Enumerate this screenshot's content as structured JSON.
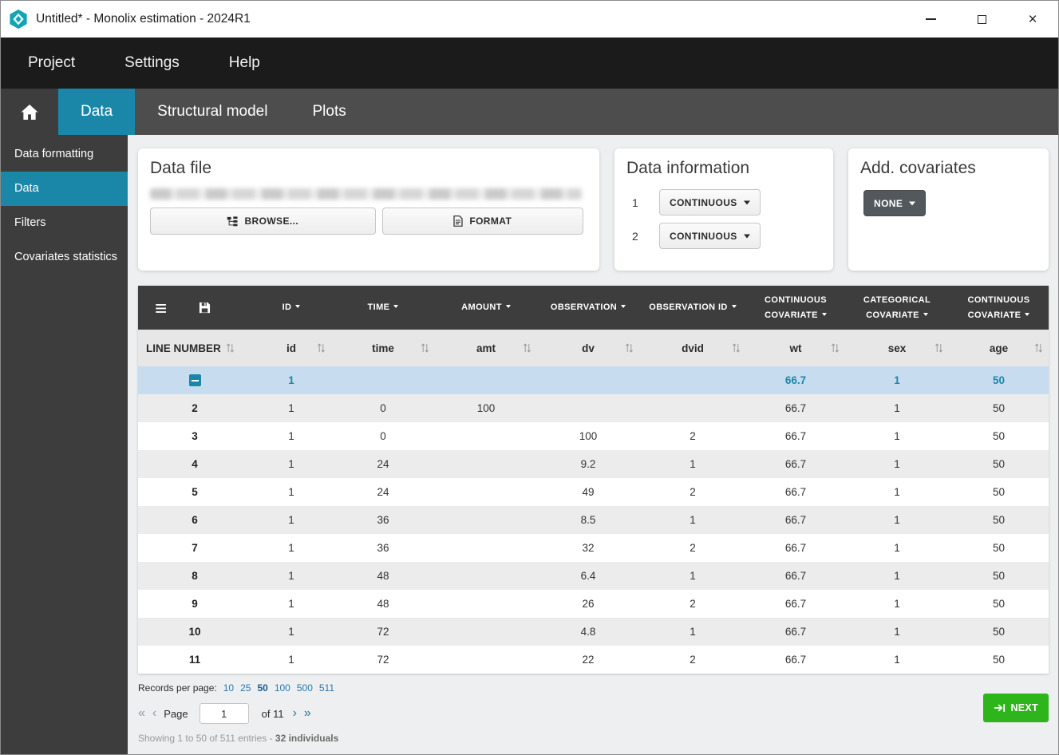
{
  "window": {
    "title": "Untitled* - Monolix estimation - 2024R1"
  },
  "icons": {
    "hamburger": "≡",
    "close": "×"
  },
  "menubar": {
    "items": [
      {
        "label": "Project"
      },
      {
        "label": "Settings"
      },
      {
        "label": "Help"
      }
    ]
  },
  "tabs": {
    "items": [
      {
        "label": "Data",
        "active": true
      },
      {
        "label": "Structural model"
      },
      {
        "label": "Plots"
      }
    ]
  },
  "sidebar": {
    "items": [
      {
        "label": "Data formatting"
      },
      {
        "label": "Data",
        "active": true
      },
      {
        "label": "Filters"
      },
      {
        "label": "Covariates statistics"
      }
    ]
  },
  "panels": {
    "data_file": {
      "title": "Data file",
      "browse_label": "BROWSE...",
      "format_label": "FORMAT"
    },
    "data_information": {
      "title": "Data information",
      "rows": [
        {
          "index": "1",
          "value": "CONTINUOUS",
          "first": true
        },
        {
          "index": "2",
          "value": "CONTINUOUS"
        }
      ]
    },
    "add_covariates": {
      "title": "Add. covariates",
      "value": "NONE"
    }
  },
  "table": {
    "group_headers": [
      {
        "label": "ID"
      },
      {
        "label": "TIME"
      },
      {
        "label": "AMOUNT"
      },
      {
        "label": "OBSERVATION"
      },
      {
        "label": "OBSERVATION ID"
      },
      {
        "label": "CONTINUOUS COVARIATE"
      },
      {
        "label": "CATEGORICAL COVARIATE"
      },
      {
        "label": "CONTINUOUS COVARIATE"
      }
    ],
    "columns": [
      {
        "label": "LINE NUMBER"
      },
      {
        "label": "id"
      },
      {
        "label": "time"
      },
      {
        "label": "amt"
      },
      {
        "label": "dv"
      },
      {
        "label": "dvid"
      },
      {
        "label": "wt"
      },
      {
        "label": "sex"
      },
      {
        "label": "age"
      }
    ],
    "rows": [
      {
        "line": "",
        "collapse": true,
        "selected": true,
        "id": "1",
        "time": "",
        "amt": "",
        "dv": "",
        "dvid": "",
        "wt": "66.7",
        "sex": "1",
        "age": "50"
      },
      {
        "line": "2",
        "id": "1",
        "time": "0",
        "amt": "100",
        "dv": "",
        "dvid": "",
        "wt": "66.7",
        "sex": "1",
        "age": "50"
      },
      {
        "line": "3",
        "id": "1",
        "time": "0",
        "amt": "",
        "dv": "100",
        "dvid": "2",
        "wt": "66.7",
        "sex": "1",
        "age": "50"
      },
      {
        "line": "4",
        "id": "1",
        "time": "24",
        "amt": "",
        "dv": "9.2",
        "dvid": "1",
        "wt": "66.7",
        "sex": "1",
        "age": "50"
      },
      {
        "line": "5",
        "id": "1",
        "time": "24",
        "amt": "",
        "dv": "49",
        "dvid": "2",
        "wt": "66.7",
        "sex": "1",
        "age": "50"
      },
      {
        "line": "6",
        "id": "1",
        "time": "36",
        "amt": "",
        "dv": "8.5",
        "dvid": "1",
        "wt": "66.7",
        "sex": "1",
        "age": "50"
      },
      {
        "line": "7",
        "id": "1",
        "time": "36",
        "amt": "",
        "dv": "32",
        "dvid": "2",
        "wt": "66.7",
        "sex": "1",
        "age": "50"
      },
      {
        "line": "8",
        "id": "1",
        "time": "48",
        "amt": "",
        "dv": "6.4",
        "dvid": "1",
        "wt": "66.7",
        "sex": "1",
        "age": "50"
      },
      {
        "line": "9",
        "id": "1",
        "time": "48",
        "amt": "",
        "dv": "26",
        "dvid": "2",
        "wt": "66.7",
        "sex": "1",
        "age": "50"
      },
      {
        "line": "10",
        "id": "1",
        "time": "72",
        "amt": "",
        "dv": "4.8",
        "dvid": "1",
        "wt": "66.7",
        "sex": "1",
        "age": "50"
      },
      {
        "line": "11",
        "id": "1",
        "time": "72",
        "amt": "",
        "dv": "22",
        "dvid": "2",
        "wt": "66.7",
        "sex": "1",
        "age": "50"
      }
    ]
  },
  "footer": {
    "records_label": "Records per page:",
    "records_options": [
      {
        "label": "10"
      },
      {
        "label": "25"
      },
      {
        "label": "50",
        "active": true
      },
      {
        "label": "100"
      },
      {
        "label": "500"
      },
      {
        "label": "511"
      }
    ],
    "pagination": {
      "first": "«",
      "prev": "‹",
      "page_label": "Page",
      "page_value": "1",
      "page_total": "of 11",
      "next": "›",
      "last": "»"
    },
    "showing_text": "Showing 1 to 50 of 511 entries -",
    "individuals_text": "32 individuals",
    "next_label": "NEXT"
  }
}
